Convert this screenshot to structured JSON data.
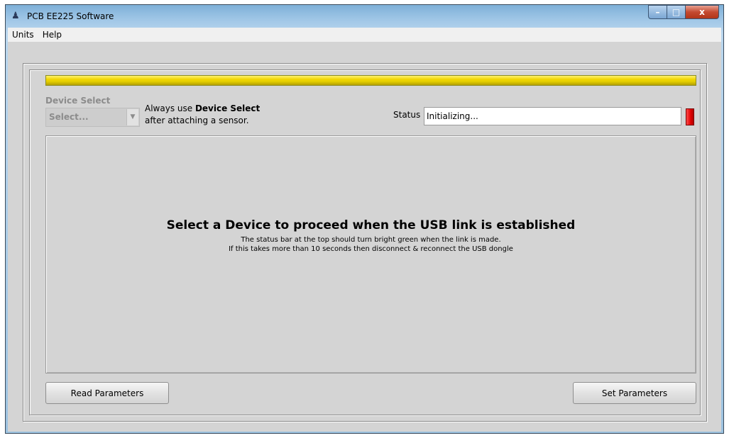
{
  "window": {
    "title": "PCB EE225 Software",
    "icon": "pcb-app-icon",
    "controls": {
      "minimize": "–",
      "maximize": "□",
      "close": "x"
    }
  },
  "menu": {
    "items": [
      {
        "label": "Units"
      },
      {
        "label": "Help"
      }
    ]
  },
  "link_status_bar": {
    "state": "initializing",
    "color": "#e6d000"
  },
  "device_select": {
    "label": "Device Select",
    "value": "Select...",
    "hint_prefix": "Always use ",
    "hint_bold": "Device Select",
    "hint_line2": "after attaching a sensor."
  },
  "status": {
    "label": "Status",
    "value": "Initializing...",
    "led_color": "#e00000"
  },
  "message": {
    "title": "Select a Device to proceed when the USB link is established",
    "line1": "The status bar at the top should turn bright green when the link is made.",
    "line2": "If this takes more than 10 seconds then disconnect & reconnect the USB dongle"
  },
  "buttons": {
    "read": "Read Parameters",
    "set": "Set Parameters"
  }
}
